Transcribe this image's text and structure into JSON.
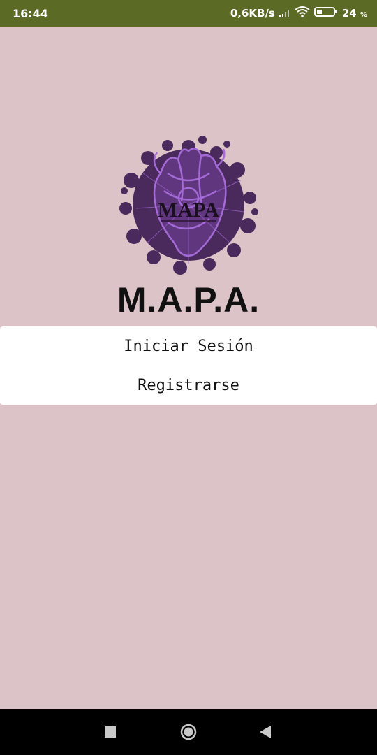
{
  "status_bar": {
    "time": "16:44",
    "network_speed": "0,6KB/s",
    "battery_level": "24",
    "battery_unit": "%",
    "icons": [
      "signal-icon",
      "wifi-icon",
      "battery-icon"
    ]
  },
  "logo": {
    "text": "MAPA",
    "icon": "anatomical-heart-logo",
    "colors": {
      "splash": "#4a2a5c",
      "heart": "#a46ad6"
    }
  },
  "app": {
    "title": "M.A.P.A."
  },
  "actions": {
    "login_label": "Iniciar Sesión",
    "register_label": "Registrarse"
  },
  "nav_bar": {
    "icons": [
      "recent-apps-icon",
      "home-icon",
      "back-icon"
    ]
  },
  "colors": {
    "background": "#dcc3c7",
    "status_bar": "#5b6a24",
    "button_surface": "#ffffff"
  }
}
